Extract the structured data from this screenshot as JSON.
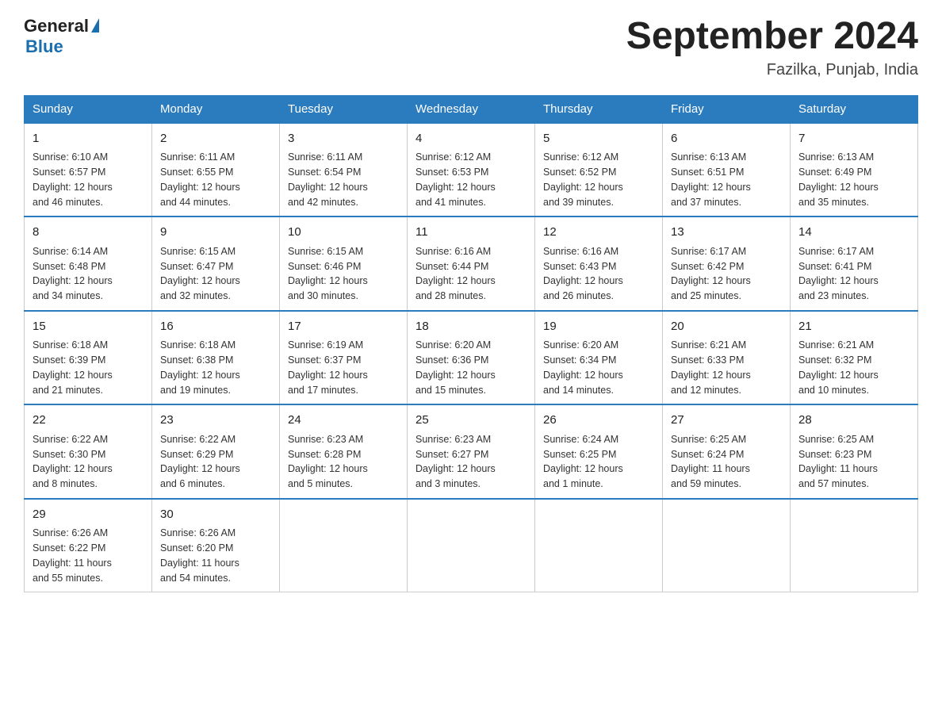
{
  "logo": {
    "general": "General",
    "blue": "Blue"
  },
  "header": {
    "title": "September 2024",
    "location": "Fazilka, Punjab, India"
  },
  "weekdays": [
    "Sunday",
    "Monday",
    "Tuesday",
    "Wednesday",
    "Thursday",
    "Friday",
    "Saturday"
  ],
  "weeks": [
    [
      {
        "day": "1",
        "sunrise": "6:10 AM",
        "sunset": "6:57 PM",
        "daylight": "12 hours and 46 minutes."
      },
      {
        "day": "2",
        "sunrise": "6:11 AM",
        "sunset": "6:55 PM",
        "daylight": "12 hours and 44 minutes."
      },
      {
        "day": "3",
        "sunrise": "6:11 AM",
        "sunset": "6:54 PM",
        "daylight": "12 hours and 42 minutes."
      },
      {
        "day": "4",
        "sunrise": "6:12 AM",
        "sunset": "6:53 PM",
        "daylight": "12 hours and 41 minutes."
      },
      {
        "day": "5",
        "sunrise": "6:12 AM",
        "sunset": "6:52 PM",
        "daylight": "12 hours and 39 minutes."
      },
      {
        "day": "6",
        "sunrise": "6:13 AM",
        "sunset": "6:51 PM",
        "daylight": "12 hours and 37 minutes."
      },
      {
        "day": "7",
        "sunrise": "6:13 AM",
        "sunset": "6:49 PM",
        "daylight": "12 hours and 35 minutes."
      }
    ],
    [
      {
        "day": "8",
        "sunrise": "6:14 AM",
        "sunset": "6:48 PM",
        "daylight": "12 hours and 34 minutes."
      },
      {
        "day": "9",
        "sunrise": "6:15 AM",
        "sunset": "6:47 PM",
        "daylight": "12 hours and 32 minutes."
      },
      {
        "day": "10",
        "sunrise": "6:15 AM",
        "sunset": "6:46 PM",
        "daylight": "12 hours and 30 minutes."
      },
      {
        "day": "11",
        "sunrise": "6:16 AM",
        "sunset": "6:44 PM",
        "daylight": "12 hours and 28 minutes."
      },
      {
        "day": "12",
        "sunrise": "6:16 AM",
        "sunset": "6:43 PM",
        "daylight": "12 hours and 26 minutes."
      },
      {
        "day": "13",
        "sunrise": "6:17 AM",
        "sunset": "6:42 PM",
        "daylight": "12 hours and 25 minutes."
      },
      {
        "day": "14",
        "sunrise": "6:17 AM",
        "sunset": "6:41 PM",
        "daylight": "12 hours and 23 minutes."
      }
    ],
    [
      {
        "day": "15",
        "sunrise": "6:18 AM",
        "sunset": "6:39 PM",
        "daylight": "12 hours and 21 minutes."
      },
      {
        "day": "16",
        "sunrise": "6:18 AM",
        "sunset": "6:38 PM",
        "daylight": "12 hours and 19 minutes."
      },
      {
        "day": "17",
        "sunrise": "6:19 AM",
        "sunset": "6:37 PM",
        "daylight": "12 hours and 17 minutes."
      },
      {
        "day": "18",
        "sunrise": "6:20 AM",
        "sunset": "6:36 PM",
        "daylight": "12 hours and 15 minutes."
      },
      {
        "day": "19",
        "sunrise": "6:20 AM",
        "sunset": "6:34 PM",
        "daylight": "12 hours and 14 minutes."
      },
      {
        "day": "20",
        "sunrise": "6:21 AM",
        "sunset": "6:33 PM",
        "daylight": "12 hours and 12 minutes."
      },
      {
        "day": "21",
        "sunrise": "6:21 AM",
        "sunset": "6:32 PM",
        "daylight": "12 hours and 10 minutes."
      }
    ],
    [
      {
        "day": "22",
        "sunrise": "6:22 AM",
        "sunset": "6:30 PM",
        "daylight": "12 hours and 8 minutes."
      },
      {
        "day": "23",
        "sunrise": "6:22 AM",
        "sunset": "6:29 PM",
        "daylight": "12 hours and 6 minutes."
      },
      {
        "day": "24",
        "sunrise": "6:23 AM",
        "sunset": "6:28 PM",
        "daylight": "12 hours and 5 minutes."
      },
      {
        "day": "25",
        "sunrise": "6:23 AM",
        "sunset": "6:27 PM",
        "daylight": "12 hours and 3 minutes."
      },
      {
        "day": "26",
        "sunrise": "6:24 AM",
        "sunset": "6:25 PM",
        "daylight": "12 hours and 1 minute."
      },
      {
        "day": "27",
        "sunrise": "6:25 AM",
        "sunset": "6:24 PM",
        "daylight": "11 hours and 59 minutes."
      },
      {
        "day": "28",
        "sunrise": "6:25 AM",
        "sunset": "6:23 PM",
        "daylight": "11 hours and 57 minutes."
      }
    ],
    [
      {
        "day": "29",
        "sunrise": "6:26 AM",
        "sunset": "6:22 PM",
        "daylight": "11 hours and 55 minutes."
      },
      {
        "day": "30",
        "sunrise": "6:26 AM",
        "sunset": "6:20 PM",
        "daylight": "11 hours and 54 minutes."
      },
      null,
      null,
      null,
      null,
      null
    ]
  ],
  "labels": {
    "sunrise": "Sunrise:",
    "sunset": "Sunset:",
    "daylight": "Daylight:"
  }
}
